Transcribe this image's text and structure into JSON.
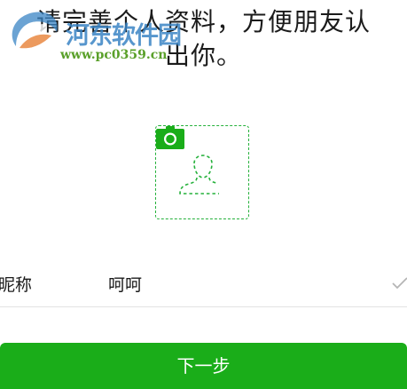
{
  "header": {
    "line1": "请完善个人资料，方便朋友认",
    "line2": "出你。"
  },
  "watermark": {
    "name": "河东软件园",
    "url": "www.pc0359.cn"
  },
  "avatar": {
    "placeholder_icon": "person-outline-icon",
    "badge_icon": "camera-icon"
  },
  "form": {
    "nickname_label": "昵称",
    "nickname_value": "呵呵",
    "status_icon": "check-icon"
  },
  "actions": {
    "next_label": "下一步"
  },
  "colors": {
    "accent": "#1aad19",
    "dashed_border": "#25b13b",
    "divider": "#e3e3e3",
    "watermark_blue": "#3a84c4",
    "watermark_green": "#5aa02a"
  }
}
